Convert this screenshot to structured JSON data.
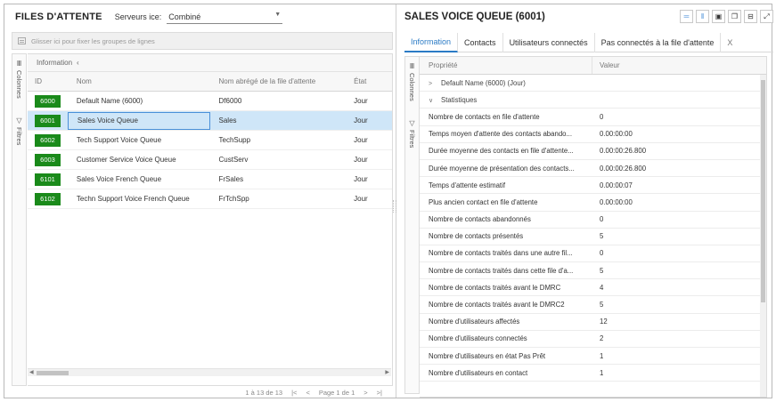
{
  "left": {
    "title": "FILES D'ATTENTE",
    "server_label": "Serveurs ice:",
    "server_value": "Combiné",
    "group_placeholder": "Glisser ici pour fixer les groupes de lignes",
    "vtabs": {
      "columns": "Colonnes",
      "filters": "Filtres"
    },
    "info_header": "Information",
    "columns": [
      "ID",
      "Nom",
      "Nom abrégé de la file d'attente",
      "État"
    ],
    "rows": [
      {
        "id": "6000",
        "nom": "Default Name (6000)",
        "abrege": "Df6000",
        "etat": "Jour"
      },
      {
        "id": "6001",
        "nom": "Sales Voice Queue",
        "abrege": "Sales",
        "etat": "Jour"
      },
      {
        "id": "6002",
        "nom": "Tech Support Voice Queue",
        "abrege": "TechSupp",
        "etat": "Jour"
      },
      {
        "id": "6003",
        "nom": "Customer Service Voice Queue",
        "abrege": "CustServ",
        "etat": "Jour"
      },
      {
        "id": "6101",
        "nom": "Sales Voice French Queue",
        "abrege": "FrSales",
        "etat": "Jour"
      },
      {
        "id": "6102",
        "nom": "Techn Support Voice French Queue",
        "abrege": "FrTchSpp",
        "etat": "Jour"
      }
    ],
    "pager": {
      "range": "1 à 13 de 13",
      "page": "Page 1 de 1"
    },
    "colors": {
      "badge": "#1a8a1a",
      "selected_row": "#cfe6f8"
    }
  },
  "right": {
    "title": "SALES VOICE QUEUE (6001)",
    "tabs": [
      "Information",
      "Contacts",
      "Utilisateurs connectés",
      "Pas connectés à la file d'attente"
    ],
    "tab_close": "X",
    "vtabs": {
      "columns": "Colonnes",
      "filters": "Filtres"
    },
    "headers": {
      "prop": "Propriété",
      "value": "Valeur"
    },
    "group_default": "Default Name (6000) (Jour)",
    "group_stats": "Statistiques",
    "props": [
      {
        "p": "Nombre de contacts en file d'attente",
        "v": "0"
      },
      {
        "p": "Temps moyen d'attente des contacts abando...",
        "v": "0.00:00:00"
      },
      {
        "p": "Durée moyenne des contacts en file d'attente...",
        "v": "0.00:00:26.800"
      },
      {
        "p": "Durée moyenne de présentation des contacts...",
        "v": "0.00:00:26.800"
      },
      {
        "p": "Temps d'attente estimatif",
        "v": "0.00:00:07"
      },
      {
        "p": "Plus ancien contact en file d'attente",
        "v": "0.00:00:00"
      },
      {
        "p": "Nombre de contacts abandonnés",
        "v": "0"
      },
      {
        "p": "Nombre de contacts présentés",
        "v": "5"
      },
      {
        "p": "Nombre de contacts traités dans une autre fil...",
        "v": "0"
      },
      {
        "p": "Nombre de contacts traités dans cette file d'a...",
        "v": "5"
      },
      {
        "p": "Nombre de contacts traités avant le DMRC",
        "v": "4"
      },
      {
        "p": "Nombre de contacts traités avant le DMRC2",
        "v": "5"
      },
      {
        "p": "Nombre d'utilisateurs affectés",
        "v": "12"
      },
      {
        "p": "Nombre d'utilisateurs connectés",
        "v": "2"
      },
      {
        "p": "Nombre d'utilisateurs en état Pas Prêt",
        "v": "1"
      },
      {
        "p": "Nombre d'utilisateurs en contact",
        "v": "1"
      }
    ],
    "accent": "#2b7bc5"
  }
}
